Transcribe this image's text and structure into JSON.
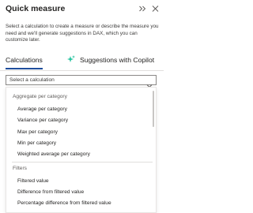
{
  "panel": {
    "title": "Quick measure",
    "description": "Select a calculation to create a measure or describe the measure you need and we'll generate suggestions in DAX, which you can customize later."
  },
  "tabs": [
    {
      "label": "Calculations",
      "selected": true
    },
    {
      "label": "Suggestions with Copilot",
      "selected": false
    }
  ],
  "calculation_select": {
    "placeholder": "Select a calculation"
  },
  "dropdown": {
    "groups": [
      {
        "header": "Aggregate per category",
        "items": [
          "Average per category",
          "Variance per category",
          "Max per category",
          "Min per category",
          "Weighted average per category"
        ]
      },
      {
        "header": "Filters",
        "items": [
          "Filtered value",
          "Difference from filtered value",
          "Percentage difference from filtered value"
        ]
      }
    ]
  },
  "colors": {
    "accent": "#1f4e9c",
    "copilot_icon": "#27c4a0"
  }
}
